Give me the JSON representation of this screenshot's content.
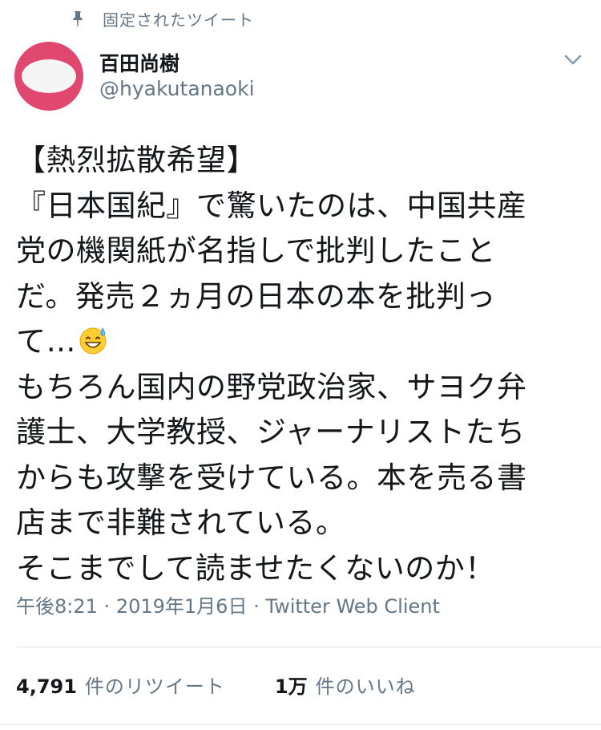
{
  "pinned": {
    "icon": "pin-icon",
    "label": "固定されたツイート"
  },
  "author": {
    "avatar_color": "#e0486f",
    "name": "百田尚樹",
    "handle": "@hyakutanaoki"
  },
  "tweet": {
    "lines": [
      "【熱烈拡散希望】",
      "『日本国紀』で驚いたのは、中国共産",
      "党の機関紙が名指しで批判したこと",
      "だ。発売２ヵ月の日本の本を批判っ",
      "て…",
      "もちろん国内の野党政治家、サヨク弁",
      "護士、大学教授、ジャーナリストたち",
      "からも攻撃を受けている。本を売る書",
      "店まで非難されている。",
      "そこまでして読ませたくないのか！"
    ],
    "emoji": "grinning-face-with-sweat-emoji"
  },
  "meta": {
    "time": "午後8:21",
    "separator": "·",
    "date": "2019年1月6日",
    "source": "Twitter Web Client"
  },
  "stats": {
    "retweets_count": "4,791",
    "retweets_label": "件のリツイート",
    "likes_count": "1万",
    "likes_label": "件のいいね"
  },
  "colors": {
    "text": "#14171a",
    "secondary": "#657786",
    "divider": "#dfe3e6"
  }
}
